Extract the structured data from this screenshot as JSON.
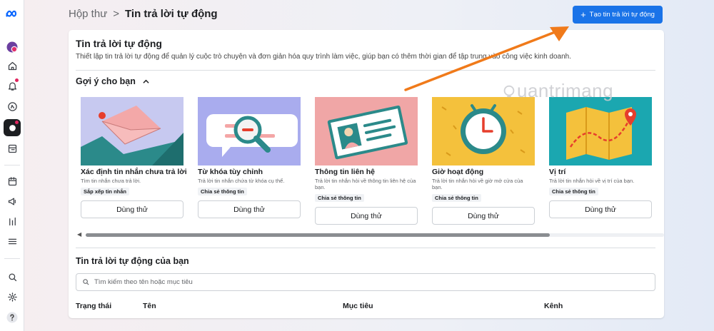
{
  "sidebar": {
    "icons": [
      "meta-logo-icon",
      "profile-avatar-icon",
      "home-icon",
      "notifications-icon",
      "compass-icon",
      "inbox-icon",
      "content-icon",
      "calendar-icon",
      "megaphone-icon",
      "insights-icon",
      "menu-icon",
      "search-icon",
      "settings-icon",
      "help-icon"
    ]
  },
  "header": {
    "breadcrumb_parent": "Hộp thư",
    "breadcrumb_sep": ">",
    "breadcrumb_current": "Tin trả lời tự động",
    "create_button": "Tạo tin trả lời tự động",
    "create_icon": "+"
  },
  "main": {
    "title": "Tin trả lời tự động",
    "description": "Thiết lập tin trả lời tự động để quản lý cuộc trò chuyện và đơn giản hóa quy trình làm việc, giúp bạn có thêm thời gian để tập trung vào công việc kinh doanh.",
    "suggestions_label": "Gợi ý cho bạn",
    "templates": [
      {
        "title": "Xác định tin nhắn chưa trả lời",
        "desc": "Tìm tin nhắn chưa trả lời.",
        "tag": "Sắp xếp tin nhắn",
        "button": "Dùng thử",
        "bg": "#c7c9f0"
      },
      {
        "title": "Từ khóa tùy chỉnh",
        "desc": "Trả lời tin nhắn chứa từ khóa cụ thể.",
        "tag": "Chia sẻ thông tin",
        "button": "Dùng thử",
        "bg": "#a9acee"
      },
      {
        "title": "Thông tin liên hệ",
        "desc": "Trả lời tin nhắn hỏi về thông tin liên hệ của bạn.",
        "tag": "Chia sẻ thông tin",
        "button": "Dùng thử",
        "bg": "#f0a6a6"
      },
      {
        "title": "Giờ hoạt động",
        "desc": "Trả lời tin nhắn hỏi về giờ mở cửa của bạn.",
        "tag": "Chia sẻ thông tin",
        "button": "Dùng thử",
        "bg": "#f4c13c"
      },
      {
        "title": "Vị trí",
        "desc": "Trả lời tin nhắn hỏi về vị trí của bạn.",
        "tag": "Chia sẻ thông tin",
        "button": "Dùng thử",
        "bg": "#1ba7b0"
      }
    ],
    "your_replies_label": "Tin trả lời tự động của bạn",
    "search_placeholder": "Tìm kiếm theo tên hoặc mục tiêu",
    "columns": [
      "Trạng thái",
      "Tên",
      "Mục tiêu",
      "Kênh"
    ]
  },
  "watermark": "uantrimang",
  "colors": {
    "accent": "#1a73e8",
    "annotation_arrow": "#f07a1a"
  }
}
